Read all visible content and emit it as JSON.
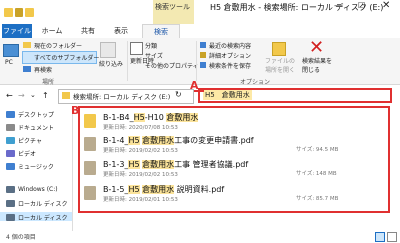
{
  "window": {
    "context_tab": "検索ツール",
    "title": "H5 倉敷用水 - 検索場所: ローカル ディスク (E:)",
    "minimize": "—",
    "maximize": "☐",
    "close": "✕"
  },
  "tabs": [
    "ファイル",
    "ホーム",
    "共有",
    "表示",
    "検索"
  ],
  "ribbon": {
    "pc": "PC",
    "current_folder": "現在のフォルダー",
    "all_subfolders": "すべてのサブフォルダー",
    "search_again": "再検索",
    "refine": "絞り込み",
    "modified_date": "更新日時",
    "kind": "分類",
    "size": "サイズ",
    "other_props": "その他のプロパティ",
    "recent_searches": "最近の検索内容",
    "advanced": "詳細オプション",
    "save_search": "検索条件を保存",
    "open_location": "ファイルの場所を開く",
    "close_search": "検索結果を閉じる",
    "group_location": "場所",
    "group_options": "オプション"
  },
  "address": {
    "path": "検索場所: ローカル ディスク (E:)",
    "search_query": "H5　倉敷用水",
    "callout_a": "A",
    "callout_b": "B"
  },
  "nav": [
    {
      "label": "デスクトップ",
      "color": "#3f7fd0"
    },
    {
      "label": "ドキュメント",
      "color": "#8a8a8a"
    },
    {
      "label": "ピクチャ",
      "color": "#3f9fd0"
    },
    {
      "label": "ビデオ",
      "color": "#6a6acb"
    },
    {
      "label": "ミュージック",
      "color": "#3f7fd0"
    },
    {
      "label": "Windows (C:)",
      "color": "#5a6f85"
    },
    {
      "label": "ローカル ディスク",
      "color": "#5a6f85"
    },
    {
      "label": "ローカル ディスク",
      "color": "#5a6f85"
    }
  ],
  "results": [
    {
      "name_pre": "B-1-B4_",
      "name_hl": "H5",
      "name_mid": "-H10 ",
      "name_hl2": "倉敷用水",
      "name_post": "",
      "date": "更新日時: 2020/07/08 10:53",
      "size": "",
      "kind": "folder"
    },
    {
      "name_pre": "B-1-4_",
      "name_hl": "H5",
      "name_mid": " ",
      "name_hl2": "倉敷用水",
      "name_post": "工事の変更申請書.pdf",
      "date": "更新日時: 2019/02/02 10:53",
      "size": "サイズ: 94.5 MB",
      "kind": "pdf"
    },
    {
      "name_pre": "B-1-3_",
      "name_hl": "H5",
      "name_mid": " ",
      "name_hl2": "倉敷用水",
      "name_post": "工事 管理者協議.pdf",
      "date": "更新日時: 2019/02/02 10:53",
      "size": "サイズ: 148 MB",
      "kind": "pdf"
    },
    {
      "name_pre": "B-1-5_",
      "name_hl": "H5",
      "name_mid": " ",
      "name_hl2": "倉敷用水",
      "name_post": " 説明資料.pdf",
      "date": "更新日時: 2019/02/01 10:53",
      "size": "サイズ: 85.7 MB",
      "kind": "pdf"
    }
  ],
  "status": {
    "count": "4 個の項目"
  },
  "colors": {
    "accent": "#1d6fc4",
    "callout": "#e03030",
    "highlight": "#fbe39a"
  }
}
